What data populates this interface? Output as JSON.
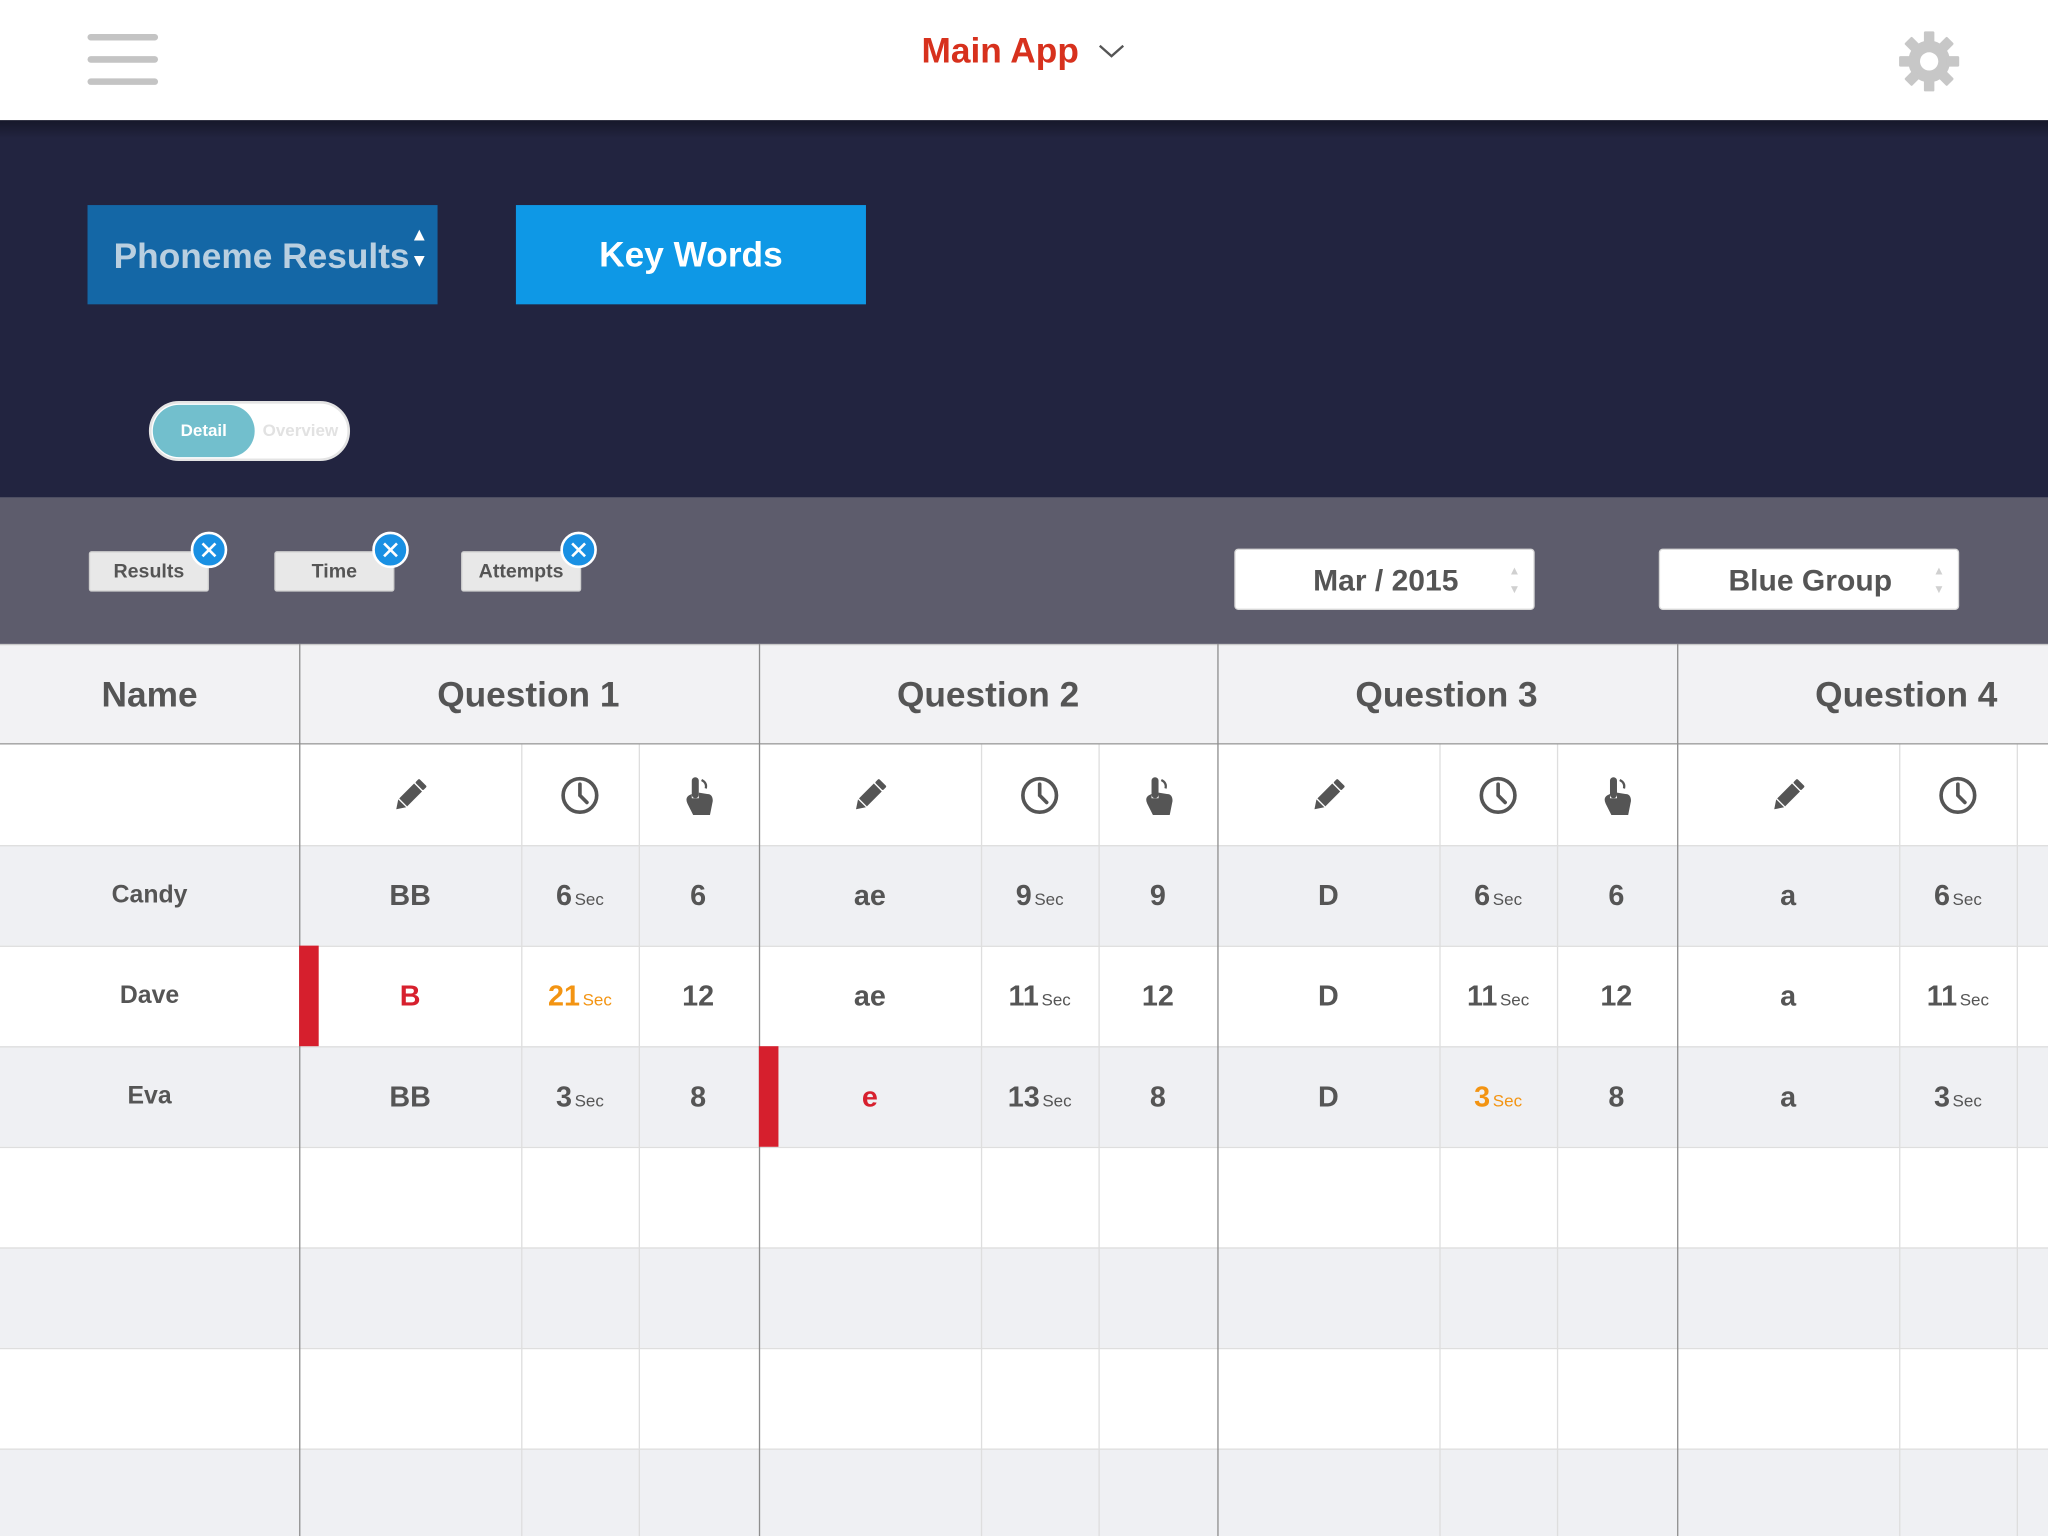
{
  "header": {
    "app_title": "Main App"
  },
  "tabs": {
    "phoneme_results": "Phoneme Results",
    "key_words": "Key Words"
  },
  "view_toggle": {
    "active": "Detail",
    "inactive": "Overview"
  },
  "filters": {
    "chips": [
      "Results",
      "Time",
      "Attempts"
    ],
    "date": "Mar / 2015",
    "group": "Blue Group"
  },
  "table": {
    "name_header": "Name",
    "questions": [
      "Question 1",
      "Question 2",
      "Question 3",
      "Question 4"
    ],
    "column_icons": [
      "pencil-icon",
      "clock-icon",
      "pointer-hand-icon"
    ],
    "time_unit": "Sec",
    "rows": [
      {
        "name": "Candy",
        "answers": [
          {
            "result": "BB",
            "time": "6",
            "attempts": "6"
          },
          {
            "result": "ae",
            "time": "9",
            "attempts": "9"
          },
          {
            "result": "D",
            "time": "6",
            "attempts": "6"
          },
          {
            "result": "a",
            "time": "6",
            "attempts": ""
          }
        ]
      },
      {
        "name": "Dave",
        "answers": [
          {
            "result": "B",
            "time": "21",
            "attempts": "12",
            "result_flag": "incorrect",
            "time_flag": "slow"
          },
          {
            "result": "ae",
            "time": "11",
            "attempts": "12"
          },
          {
            "result": "D",
            "time": "11",
            "attempts": "12"
          },
          {
            "result": "a",
            "time": "11",
            "attempts": ""
          }
        ]
      },
      {
        "name": "Eva",
        "answers": [
          {
            "result": "BB",
            "time": "3",
            "attempts": "8"
          },
          {
            "result": "e",
            "time": "13",
            "attempts": "8",
            "result_flag": "incorrect"
          },
          {
            "result": "D",
            "time": "3",
            "attempts": "8",
            "time_flag": "slow"
          },
          {
            "result": "a",
            "time": "3",
            "attempts": ""
          }
        ]
      }
    ]
  },
  "colors": {
    "brand_red": "#d7311d",
    "header_dark": "#222440",
    "filter_bar": "#5d5c6c",
    "tab_selected": "#1467a6",
    "tab_accent": "#0e98e6",
    "toggle_on": "#72bfcd",
    "chip_close": "#1990e3",
    "incorrect": "#d61f2d",
    "slow": "#f39412"
  }
}
